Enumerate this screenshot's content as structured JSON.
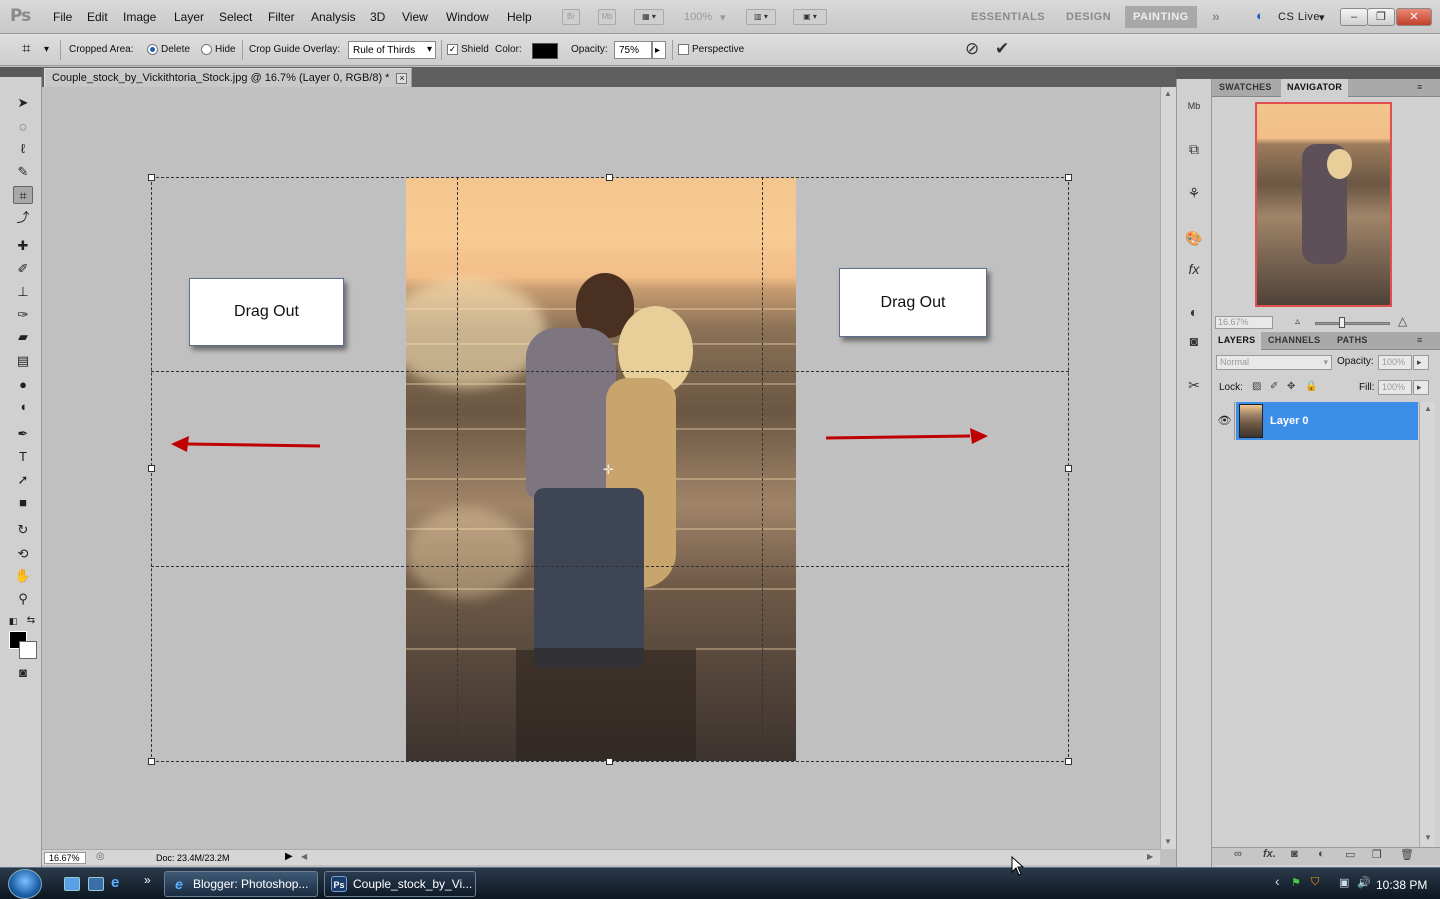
{
  "app": {
    "logo": "Ps",
    "menu": [
      "File",
      "Edit",
      "Image",
      "Layer",
      "Select",
      "Filter",
      "Analysis",
      "3D",
      "View",
      "Window",
      "Help"
    ],
    "menubar_buttons": {
      "bridge": "Br",
      "mini_bridge": "Mb",
      "zoom_level": "100%"
    },
    "workspaces": [
      "ESSENTIALS",
      "DESIGN",
      "PAINTING"
    ],
    "active_workspace": "PAINTING",
    "more_workspaces": "»",
    "cs_live": "CS Live",
    "window_controls": {
      "minimize": "–",
      "restore": "❐",
      "close": "✕"
    }
  },
  "options_bar": {
    "cropped_area_label": "Cropped Area:",
    "delete_label": "Delete",
    "hide_label": "Hide",
    "cropped_area_value": "Delete",
    "overlay_label": "Crop Guide Overlay:",
    "overlay_value": "Rule of Thirds",
    "shield_label": "Shield",
    "shield_checked": true,
    "color_label": "Color:",
    "shield_color": "#000000",
    "opacity_label": "Opacity:",
    "opacity_value": "75%",
    "perspective_label": "Perspective",
    "perspective_checked": false,
    "cancel_icon": "cancel-icon",
    "commit_icon": "commit-checkmark-icon"
  },
  "document": {
    "tab_title": "Couple_stock_by_Vickithtoria_Stock.jpg @ 16.7% (Layer 0, RGB/8) *",
    "close": "×",
    "zoom": "16.67%",
    "doc_info": "Doc: 23.4M/23.2M"
  },
  "annotations": {
    "left_box": "Drag Out",
    "right_box": "Drag Out",
    "arrow_color": "#c00000"
  },
  "tools": [
    "move-tool-icon",
    "marquee-tool-icon",
    "lasso-tool-icon",
    "quick-selection-tool-icon",
    "crop-tool-icon",
    "eyedropper-tool-icon",
    "healing-brush-tool-icon",
    "brush-tool-icon",
    "clone-stamp-tool-icon",
    "history-brush-tool-icon",
    "eraser-tool-icon",
    "gradient-tool-icon",
    "blur-tool-icon",
    "dodge-tool-icon",
    "pen-tool-icon",
    "type-tool-icon",
    "path-selection-tool-icon",
    "rectangle-tool-icon",
    "3d-rotate-tool-icon",
    "3d-orbit-tool-icon",
    "hand-tool-icon",
    "zoom-tool-icon"
  ],
  "active_tool": "crop-tool-icon",
  "colors": {
    "foreground": "#000000",
    "background": "#ffffff",
    "selected_layer": "#3d8ee8",
    "navigator_proxy": "#e05050"
  },
  "navigator_panel": {
    "tabs": [
      "SWATCHES",
      "NAVIGATOR"
    ],
    "active_tab": "NAVIGATOR",
    "zoom": "16.67%"
  },
  "layers_panel": {
    "tabs": [
      "LAYERS",
      "CHANNELS",
      "PATHS"
    ],
    "active_tab": "LAYERS",
    "blend_mode": "Normal",
    "opacity_label": "Opacity:",
    "opacity_value": "100%",
    "lock_label": "Lock:",
    "fill_label": "Fill:",
    "fill_value": "100%",
    "layers": [
      {
        "name": "Layer 0",
        "visible": true,
        "selected": true
      }
    ],
    "bottom_icons": [
      "link-layers-icon",
      "fx-icon",
      "layer-mask-icon",
      "adjustment-layer-icon",
      "new-group-icon",
      "new-layer-icon",
      "delete-layer-icon"
    ],
    "fx_label": "fx."
  },
  "taskbar": {
    "buttons": [
      {
        "label": "Blogger: Photoshop...",
        "icon": "e"
      },
      {
        "label": "Couple_stock_by_Vi...",
        "icon": "Ps"
      }
    ],
    "clock": "10:38 PM",
    "expand": "»",
    "tray_arrow": "‹"
  }
}
